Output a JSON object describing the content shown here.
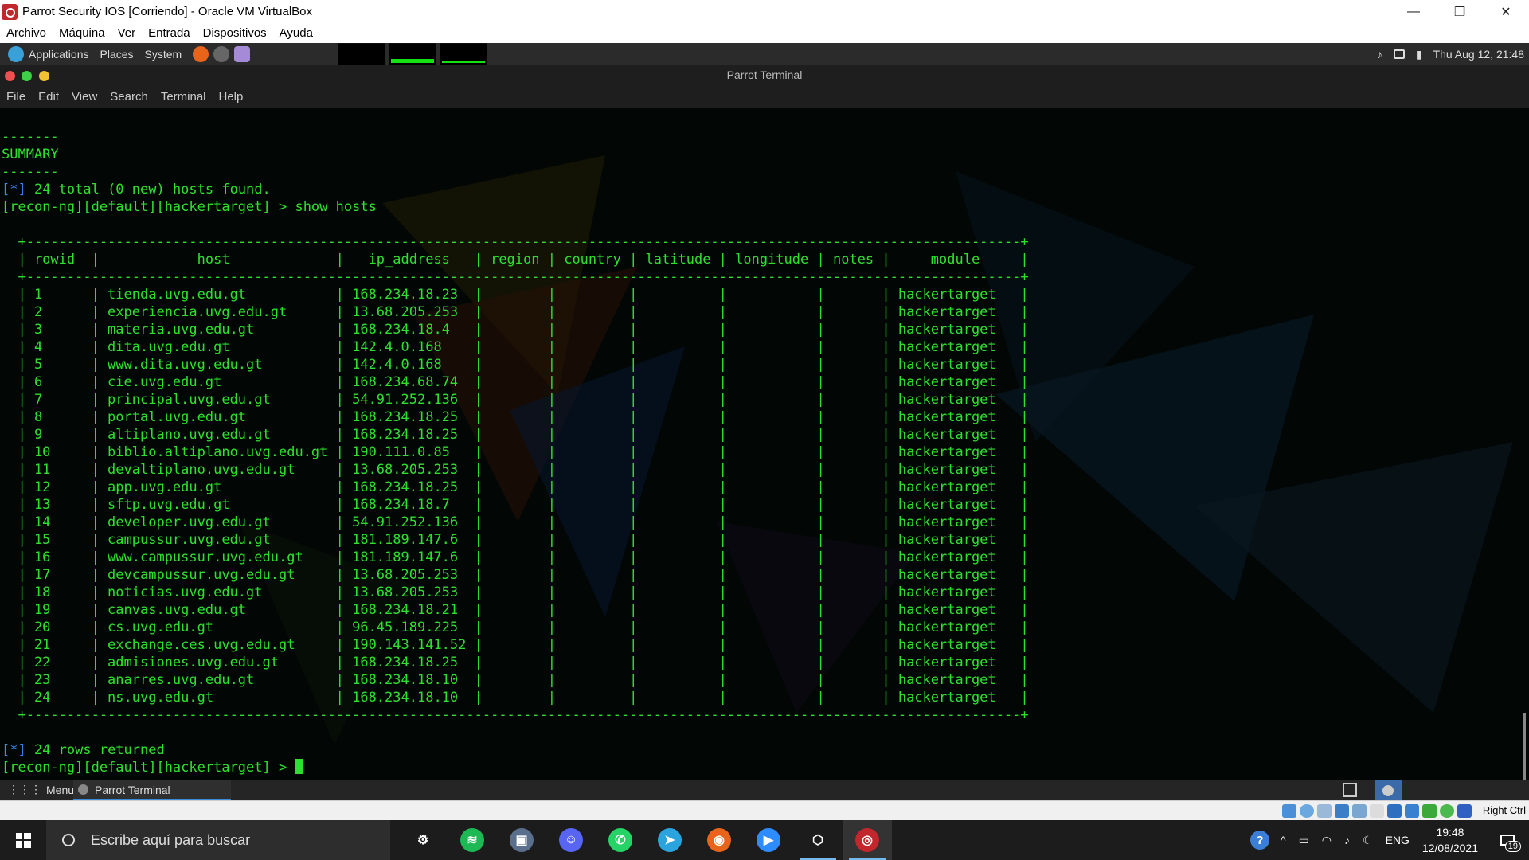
{
  "vbox": {
    "window_title": "Parrot Security IOS [Corriendo] - Oracle VM VirtualBox",
    "controls": {
      "minimize": "—",
      "restore": "❐",
      "close": "✕"
    },
    "menu": [
      "Archivo",
      "Máquina",
      "Ver",
      "Entrada",
      "Dispositivos",
      "Ayuda"
    ],
    "host_key": "Right Ctrl"
  },
  "parrot_panel": {
    "applications": "Applications",
    "places": "Places",
    "system": "System",
    "clock": "Thu Aug 12, 21:48"
  },
  "terminal": {
    "title": "Parrot Terminal",
    "menu": [
      "File",
      "Edit",
      "View",
      "Search",
      "Terminal",
      "Help"
    ],
    "intro": {
      "dashes": "-------",
      "summary": "SUMMARY",
      "total_found": "24 total (0 new) hosts found.",
      "prompt": "[recon-ng][default][hackertarget] > ",
      "command": "show hosts"
    },
    "table": {
      "columns": [
        "rowid",
        "host",
        "ip_address",
        "region",
        "country",
        "latitude",
        "longitude",
        "notes",
        "module"
      ],
      "rows": [
        [
          "1",
          "tienda.uvg.edu.gt",
          "168.234.18.23",
          "",
          "",
          "",
          "",
          "",
          "hackertarget"
        ],
        [
          "2",
          "experiencia.uvg.edu.gt",
          "13.68.205.253",
          "",
          "",
          "",
          "",
          "",
          "hackertarget"
        ],
        [
          "3",
          "materia.uvg.edu.gt",
          "168.234.18.4",
          "",
          "",
          "",
          "",
          "",
          "hackertarget"
        ],
        [
          "4",
          "dita.uvg.edu.gt",
          "142.4.0.168",
          "",
          "",
          "",
          "",
          "",
          "hackertarget"
        ],
        [
          "5",
          "www.dita.uvg.edu.gt",
          "142.4.0.168",
          "",
          "",
          "",
          "",
          "",
          "hackertarget"
        ],
        [
          "6",
          "cie.uvg.edu.gt",
          "168.234.68.74",
          "",
          "",
          "",
          "",
          "",
          "hackertarget"
        ],
        [
          "7",
          "principal.uvg.edu.gt",
          "54.91.252.136",
          "",
          "",
          "",
          "",
          "",
          "hackertarget"
        ],
        [
          "8",
          "portal.uvg.edu.gt",
          "168.234.18.25",
          "",
          "",
          "",
          "",
          "",
          "hackertarget"
        ],
        [
          "9",
          "altiplano.uvg.edu.gt",
          "168.234.18.25",
          "",
          "",
          "",
          "",
          "",
          "hackertarget"
        ],
        [
          "10",
          "biblio.altiplano.uvg.edu.gt",
          "190.111.0.85",
          "",
          "",
          "",
          "",
          "",
          "hackertarget"
        ],
        [
          "11",
          "devaltiplano.uvg.edu.gt",
          "13.68.205.253",
          "",
          "",
          "",
          "",
          "",
          "hackertarget"
        ],
        [
          "12",
          "app.uvg.edu.gt",
          "168.234.18.25",
          "",
          "",
          "",
          "",
          "",
          "hackertarget"
        ],
        [
          "13",
          "sftp.uvg.edu.gt",
          "168.234.18.7",
          "",
          "",
          "",
          "",
          "",
          "hackertarget"
        ],
        [
          "14",
          "developer.uvg.edu.gt",
          "54.91.252.136",
          "",
          "",
          "",
          "",
          "",
          "hackertarget"
        ],
        [
          "15",
          "campussur.uvg.edu.gt",
          "181.189.147.6",
          "",
          "",
          "",
          "",
          "",
          "hackertarget"
        ],
        [
          "16",
          "www.campussur.uvg.edu.gt",
          "181.189.147.6",
          "",
          "",
          "",
          "",
          "",
          "hackertarget"
        ],
        [
          "17",
          "devcampussur.uvg.edu.gt",
          "13.68.205.253",
          "",
          "",
          "",
          "",
          "",
          "hackertarget"
        ],
        [
          "18",
          "noticias.uvg.edu.gt",
          "13.68.205.253",
          "",
          "",
          "",
          "",
          "",
          "hackertarget"
        ],
        [
          "19",
          "canvas.uvg.edu.gt",
          "168.234.18.21",
          "",
          "",
          "",
          "",
          "",
          "hackertarget"
        ],
        [
          "20",
          "cs.uvg.edu.gt",
          "96.45.189.225",
          "",
          "",
          "",
          "",
          "",
          "hackertarget"
        ],
        [
          "21",
          "exchange.ces.uvg.edu.gt",
          "190.143.141.52",
          "",
          "",
          "",
          "",
          "",
          "hackertarget"
        ],
        [
          "22",
          "admisiones.uvg.edu.gt",
          "168.234.18.25",
          "",
          "",
          "",
          "",
          "",
          "hackertarget"
        ],
        [
          "23",
          "anarres.uvg.edu.gt",
          "168.234.18.10",
          "",
          "",
          "",
          "",
          "",
          "hackertarget"
        ],
        [
          "24",
          "ns.uvg.edu.gt",
          "168.234.18.10",
          "",
          "",
          "",
          "",
          "",
          "hackertarget"
        ]
      ]
    },
    "outro": {
      "rows_returned": "24 rows returned",
      "prompt": "[recon-ng][default][hackertarget] > "
    },
    "colors": {
      "text": "#2ee02e",
      "marker": "#3b8dff",
      "background": "#020605"
    }
  },
  "parrot_bottom": {
    "menu": "Menu",
    "task": "Parrot Terminal"
  },
  "windows": {
    "search_placeholder": "Escribe aquí para buscar",
    "apps": [
      {
        "name": "settings-icon",
        "glyph": "⚙"
      },
      {
        "name": "spotify-icon",
        "glyph": "≋"
      },
      {
        "name": "photos-icon",
        "glyph": "▣"
      },
      {
        "name": "discord-icon",
        "glyph": "☺"
      },
      {
        "name": "whatsapp-icon",
        "glyph": "✆"
      },
      {
        "name": "telegram-icon",
        "glyph": "➤"
      },
      {
        "name": "firefox-icon",
        "glyph": "◉"
      },
      {
        "name": "zoom-icon",
        "glyph": "▶"
      },
      {
        "name": "virtualbox-icon",
        "glyph": "⬡"
      },
      {
        "name": "parrot-vm-icon",
        "glyph": "◎"
      }
    ],
    "help": "?",
    "tray_chevron": "^",
    "lang": "ENG",
    "time": "19:48",
    "date": "12/08/2021",
    "notifications": "19"
  }
}
